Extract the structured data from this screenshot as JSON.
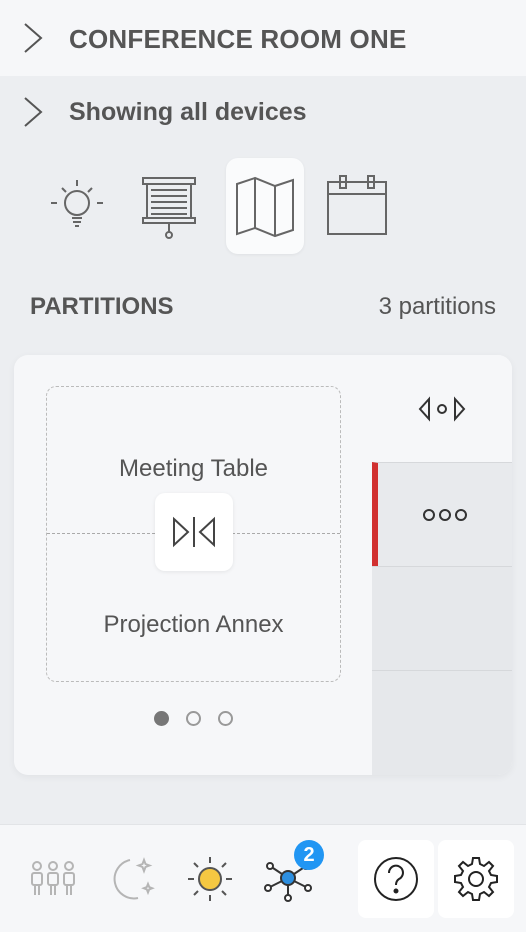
{
  "header": {
    "room_title": "CONFERENCE ROOM ONE"
  },
  "filter": {
    "label": "Showing all devices"
  },
  "categories": [
    {
      "icon": "lightbulb-icon",
      "active": false
    },
    {
      "icon": "projector-screen-icon",
      "active": false
    },
    {
      "icon": "map-icon",
      "active": true
    },
    {
      "icon": "calendar-icon",
      "active": false
    }
  ],
  "partitions": {
    "title": "PARTITIONS",
    "count_label": "3 partitions",
    "room_a": "Meeting Table",
    "room_b": "Projection Annex",
    "page_indicator": {
      "current": 1,
      "total": 3
    }
  },
  "side": {
    "top_icon": "partition-toggle-icon",
    "selected_icon": "more-icon"
  },
  "bottom_nav": {
    "items": [
      "occupancy-icon",
      "night-mode-icon",
      "day-mode-icon",
      "network-icon",
      "help-icon",
      "settings-icon"
    ],
    "network_badge": "2"
  },
  "colors": {
    "accent": "#d13030",
    "badge": "#2196f3",
    "sun": "#f5c842",
    "network": "#2d8fe0"
  }
}
